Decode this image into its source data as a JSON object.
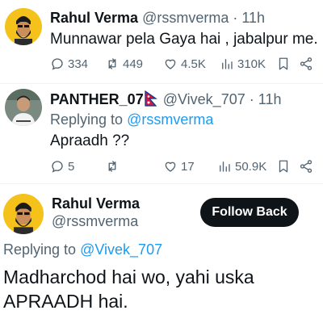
{
  "tweets": [
    {
      "name": "Rahul Verma",
      "handle": "@rssmverma",
      "time": "11h",
      "text": "Munnawar pela Gaya hai , jabalpur me.",
      "stats": {
        "replies": "334",
        "retweets": "449",
        "likes": "4.5K",
        "views": "310K"
      }
    },
    {
      "name": "PANTHER_07",
      "handle": "@Vivek_707",
      "time": "11h",
      "replying_prefix": "Replying to",
      "replying_to": "@rssmverma",
      "text": "Apraadh ??",
      "stats": {
        "replies": "5",
        "retweets": "",
        "likes": "17",
        "views": "50.9K"
      }
    },
    {
      "name": "Rahul Verma",
      "handle": "@rssmverma",
      "follow_label": "Follow Back",
      "replying_prefix": "Replying to",
      "replying_to": "@Vivek_707",
      "text_line1": "Madharchod hai wo, yahi uska",
      "text_line2": "APRAADH hai."
    }
  ],
  "colors": {
    "text": "#0f1419",
    "muted": "#536471",
    "link": "#1d9bf0",
    "button": "#0f1419"
  }
}
